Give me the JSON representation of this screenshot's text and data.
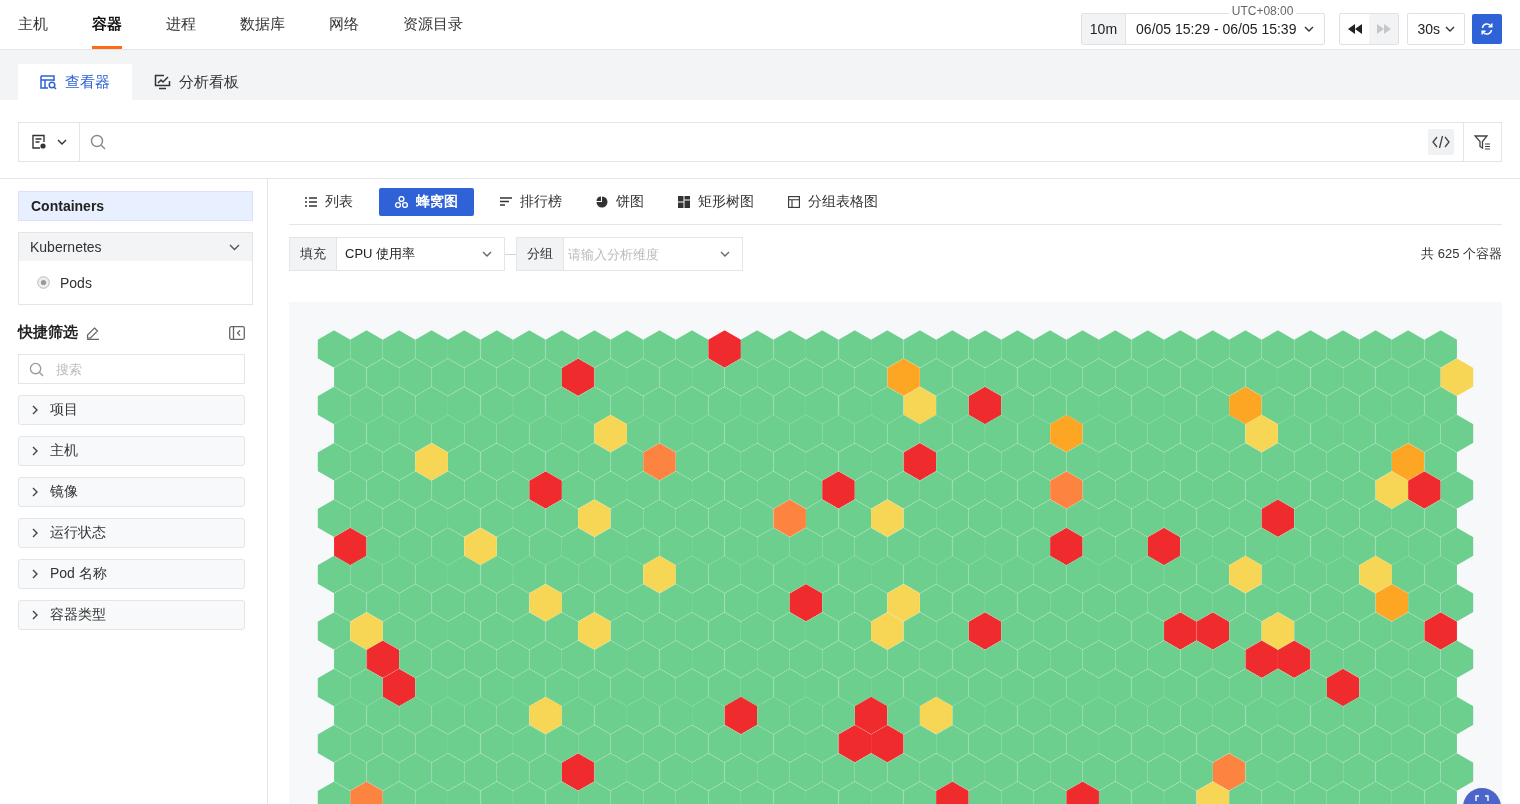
{
  "nav_tabs": [
    {
      "label": "主机",
      "selected": false
    },
    {
      "label": "容器",
      "selected": true
    },
    {
      "label": "进程",
      "selected": false
    },
    {
      "label": "数据库",
      "selected": false
    },
    {
      "label": "网络",
      "selected": false
    },
    {
      "label": "资源目录",
      "selected": false
    }
  ],
  "time_picker": {
    "timezone": "UTC+08:00",
    "quick_range": "10m",
    "range": "06/05 15:29 - 06/05 15:39"
  },
  "playback": {
    "rewind_disabled": false,
    "forward_disabled": true
  },
  "refresh_interval": "30s",
  "sub_tabs": [
    {
      "label": "查看器",
      "kind": "viewer",
      "selected": true
    },
    {
      "label": "分析看板",
      "kind": "dashboard",
      "selected": false
    }
  ],
  "sidebar": {
    "sources": [
      {
        "label": "Containers",
        "selected": true
      }
    ],
    "group": {
      "label": "Kubernetes",
      "expanded": true,
      "children": [
        {
          "label": "Pods"
        }
      ]
    },
    "quick_filter": {
      "title": "快捷筛选",
      "search_placeholder": "搜索",
      "filters": [
        {
          "label": "项目",
          "expanded": false
        },
        {
          "label": "主机",
          "expanded": false
        },
        {
          "label": "镜像",
          "expanded": false
        },
        {
          "label": "运行状态",
          "expanded": false
        },
        {
          "label": "Pod 名称",
          "expanded": false
        },
        {
          "label": "容器类型",
          "expanded": false
        }
      ]
    }
  },
  "view_tabs": [
    {
      "label": "列表",
      "kind": "list",
      "selected": false
    },
    {
      "label": "蜂窝图",
      "kind": "honeycomb",
      "selected": true
    },
    {
      "label": "排行榜",
      "kind": "ranking",
      "selected": false
    },
    {
      "label": "饼图",
      "kind": "pie",
      "selected": false
    },
    {
      "label": "矩形树图",
      "kind": "treemap",
      "selected": false
    },
    {
      "label": "分组表格图",
      "kind": "grouped-table",
      "selected": false
    }
  ],
  "fill": {
    "label": "填充",
    "value": "CPU 使用率"
  },
  "group_by": {
    "label": "分组",
    "placeholder": "请输入分析维度"
  },
  "total": "共 625 个容器",
  "honeycomb": {
    "rows": [
      [
        {
          "color": "#6dcf8e"
        },
        {
          "color": "#6dcf8e"
        },
        {
          "color": "#6dcf8e"
        },
        {
          "color": "#6dcf8e"
        },
        {
          "color": "#6dcf8e"
        },
        {
          "color": "#6dcf8e"
        },
        {
          "color": "#6dcf8e"
        },
        {
          "color": "#6dcf8e"
        },
        {
          "color": "#6dcf8e"
        },
        {
          "color": "#6dcf8e"
        },
        {
          "color": "#6dcf8e"
        },
        {
          "color": "#6dcf8e"
        },
        {
          "color": "#ef2b2d"
        },
        {
          "color": "#6dcf8e"
        },
        {
          "color": "#6dcf8e"
        },
        {
          "color": "#6dcf8e"
        },
        {
          "color": "#6dcf8e"
        },
        {
          "color": "#6dcf8e"
        },
        {
          "color": "#6dcf8e"
        },
        {
          "color": "#6dcf8e"
        },
        {
          "color": "#6dcf8e"
        },
        {
          "color": "#6dcf8e"
        },
        {
          "color": "#6dcf8e"
        },
        {
          "color": "#6dcf8e"
        },
        {
          "color": "#6dcf8e"
        },
        {
          "color": "#6dcf8e"
        },
        {
          "color": "#6dcf8e"
        },
        {
          "color": "#6dcf8e"
        },
        {
          "color": "#6dcf8e"
        },
        {
          "color": "#6dcf8e"
        },
        {
          "color": "#6dcf8e"
        },
        {
          "color": "#6dcf8e"
        },
        {
          "color": "#6dcf8e"
        },
        {
          "color": "#6dcf8e"
        },
        {
          "color": "#6dcf8e"
        }
      ],
      [
        {
          "color": "#6dcf8e"
        },
        {
          "color": "#6dcf8e"
        },
        {
          "color": "#6dcf8e"
        },
        {
          "color": "#6dcf8e"
        },
        {
          "color": "#6dcf8e"
        },
        {
          "color": "#6dcf8e"
        },
        {
          "color": "#6dcf8e"
        },
        {
          "color": "#ef2b2d"
        },
        {
          "color": "#6dcf8e"
        },
        {
          "color": "#6dcf8e"
        },
        {
          "color": "#6dcf8e"
        },
        {
          "color": "#6dcf8e"
        },
        {
          "color": "#6dcf8e"
        },
        {
          "color": "#6dcf8e"
        },
        {
          "color": "#6dcf8e"
        },
        {
          "color": "#6dcf8e"
        },
        {
          "color": "#6dcf8e"
        },
        {
          "color": "#fca623"
        },
        {
          "color": "#6dcf8e"
        },
        {
          "color": "#6dcf8e"
        },
        {
          "color": "#6dcf8e"
        },
        {
          "color": "#6dcf8e"
        },
        {
          "color": "#6dcf8e"
        },
        {
          "color": "#6dcf8e"
        },
        {
          "color": "#6dcf8e"
        },
        {
          "color": "#6dcf8e"
        },
        {
          "color": "#6dcf8e"
        },
        {
          "color": "#6dcf8e"
        },
        {
          "color": "#6dcf8e"
        },
        {
          "color": "#6dcf8e"
        },
        {
          "color": "#6dcf8e"
        },
        {
          "color": "#6dcf8e"
        },
        {
          "color": "#6dcf8e"
        },
        {
          "color": "#6dcf8e"
        },
        {
          "color": "#f6d654"
        }
      ],
      [
        {
          "color": "#6dcf8e"
        },
        {
          "color": "#6dcf8e"
        },
        {
          "color": "#6dcf8e"
        },
        {
          "color": "#6dcf8e"
        },
        {
          "color": "#6dcf8e"
        },
        {
          "color": "#6dcf8e"
        },
        {
          "color": "#6dcf8e"
        },
        {
          "color": "#6dcf8e"
        },
        {
          "color": "#6dcf8e"
        },
        {
          "color": "#6dcf8e"
        },
        {
          "color": "#6dcf8e"
        },
        {
          "color": "#6dcf8e"
        },
        {
          "color": "#6dcf8e"
        },
        {
          "color": "#6dcf8e"
        },
        {
          "color": "#6dcf8e"
        },
        {
          "color": "#6dcf8e"
        },
        {
          "color": "#6dcf8e"
        },
        {
          "color": "#6dcf8e"
        },
        {
          "color": "#f6d654"
        },
        {
          "color": "#6dcf8e"
        },
        {
          "color": "#ef2b2d"
        },
        {
          "color": "#6dcf8e"
        },
        {
          "color": "#6dcf8e"
        },
        {
          "color": "#6dcf8e"
        },
        {
          "color": "#6dcf8e"
        },
        {
          "color": "#6dcf8e"
        },
        {
          "color": "#6dcf8e"
        },
        {
          "color": "#6dcf8e"
        },
        {
          "color": "#fca623"
        },
        {
          "color": "#6dcf8e"
        },
        {
          "color": "#6dcf8e"
        },
        {
          "color": "#6dcf8e"
        },
        {
          "color": "#6dcf8e"
        },
        {
          "color": "#6dcf8e"
        },
        {
          "color": "#6dcf8e"
        }
      ],
      [
        {
          "color": "#6dcf8e"
        },
        {
          "color": "#6dcf8e"
        },
        {
          "color": "#6dcf8e"
        },
        {
          "color": "#6dcf8e"
        },
        {
          "color": "#6dcf8e"
        },
        {
          "color": "#6dcf8e"
        },
        {
          "color": "#6dcf8e"
        },
        {
          "color": "#6dcf8e"
        },
        {
          "color": "#f6d654"
        },
        {
          "color": "#6dcf8e"
        },
        {
          "color": "#6dcf8e"
        },
        {
          "color": "#6dcf8e"
        },
        {
          "color": "#6dcf8e"
        },
        {
          "color": "#6dcf8e"
        },
        {
          "color": "#6dcf8e"
        },
        {
          "color": "#6dcf8e"
        },
        {
          "color": "#6dcf8e"
        },
        {
          "color": "#6dcf8e"
        },
        {
          "color": "#6dcf8e"
        },
        {
          "color": "#6dcf8e"
        },
        {
          "color": "#6dcf8e"
        },
        {
          "color": "#6dcf8e"
        },
        {
          "color": "#fca623"
        },
        {
          "color": "#6dcf8e"
        },
        {
          "color": "#6dcf8e"
        },
        {
          "color": "#6dcf8e"
        },
        {
          "color": "#6dcf8e"
        },
        {
          "color": "#6dcf8e"
        },
        {
          "color": "#f6d654"
        },
        {
          "color": "#6dcf8e"
        },
        {
          "color": "#6dcf8e"
        },
        {
          "color": "#6dcf8e"
        },
        {
          "color": "#6dcf8e"
        },
        {
          "color": "#6dcf8e"
        },
        {
          "color": "#6dcf8e"
        }
      ],
      [
        {
          "color": "#6dcf8e"
        },
        {
          "color": "#6dcf8e"
        },
        {
          "color": "#6dcf8e"
        },
        {
          "color": "#f6d654"
        },
        {
          "color": "#6dcf8e"
        },
        {
          "color": "#6dcf8e"
        },
        {
          "color": "#6dcf8e"
        },
        {
          "color": "#6dcf8e"
        },
        {
          "color": "#6dcf8e"
        },
        {
          "color": "#6dcf8e"
        },
        {
          "color": "#fd8340"
        },
        {
          "color": "#6dcf8e"
        },
        {
          "color": "#6dcf8e"
        },
        {
          "color": "#6dcf8e"
        },
        {
          "color": "#6dcf8e"
        },
        {
          "color": "#6dcf8e"
        },
        {
          "color": "#6dcf8e"
        },
        {
          "color": "#6dcf8e"
        },
        {
          "color": "#ef2b2d"
        },
        {
          "color": "#6dcf8e"
        },
        {
          "color": "#6dcf8e"
        },
        {
          "color": "#6dcf8e"
        },
        {
          "color": "#6dcf8e"
        },
        {
          "color": "#6dcf8e"
        },
        {
          "color": "#6dcf8e"
        },
        {
          "color": "#6dcf8e"
        },
        {
          "color": "#6dcf8e"
        },
        {
          "color": "#6dcf8e"
        },
        {
          "color": "#6dcf8e"
        },
        {
          "color": "#6dcf8e"
        },
        {
          "color": "#6dcf8e"
        },
        {
          "color": "#6dcf8e"
        },
        {
          "color": "#6dcf8e"
        },
        {
          "color": "#fca623"
        },
        {
          "color": "#6dcf8e"
        }
      ],
      [
        {
          "color": "#6dcf8e"
        },
        {
          "color": "#6dcf8e"
        },
        {
          "color": "#6dcf8e"
        },
        {
          "color": "#6dcf8e"
        },
        {
          "color": "#6dcf8e"
        },
        {
          "color": "#6dcf8e"
        },
        {
          "color": "#ef2b2d"
        },
        {
          "color": "#6dcf8e"
        },
        {
          "color": "#6dcf8e"
        },
        {
          "color": "#6dcf8e"
        },
        {
          "color": "#6dcf8e"
        },
        {
          "color": "#6dcf8e"
        },
        {
          "color": "#6dcf8e"
        },
        {
          "color": "#6dcf8e"
        },
        {
          "color": "#6dcf8e"
        },
        {
          "color": "#ef2b2d"
        },
        {
          "color": "#6dcf8e"
        },
        {
          "color": "#6dcf8e"
        },
        {
          "color": "#6dcf8e"
        },
        {
          "color": "#6dcf8e"
        },
        {
          "color": "#6dcf8e"
        },
        {
          "color": "#6dcf8e"
        },
        {
          "color": "#fd8340"
        },
        {
          "color": "#6dcf8e"
        },
        {
          "color": "#6dcf8e"
        },
        {
          "color": "#6dcf8e"
        },
        {
          "color": "#6dcf8e"
        },
        {
          "color": "#6dcf8e"
        },
        {
          "color": "#6dcf8e"
        },
        {
          "color": "#6dcf8e"
        },
        {
          "color": "#6dcf8e"
        },
        {
          "color": "#6dcf8e"
        },
        {
          "color": "#f6d654"
        },
        {
          "color": "#ef2b2d"
        },
        {
          "color": "#6dcf8e"
        }
      ],
      [
        {
          "color": "#6dcf8e"
        },
        {
          "color": "#6dcf8e"
        },
        {
          "color": "#6dcf8e"
        },
        {
          "color": "#6dcf8e"
        },
        {
          "color": "#6dcf8e"
        },
        {
          "color": "#6dcf8e"
        },
        {
          "color": "#6dcf8e"
        },
        {
          "color": "#6dcf8e"
        },
        {
          "color": "#f6d654"
        },
        {
          "color": "#6dcf8e"
        },
        {
          "color": "#6dcf8e"
        },
        {
          "color": "#6dcf8e"
        },
        {
          "color": "#6dcf8e"
        },
        {
          "color": "#6dcf8e"
        },
        {
          "color": "#fd8340"
        },
        {
          "color": "#6dcf8e"
        },
        {
          "color": "#6dcf8e"
        },
        {
          "color": "#f6d654"
        },
        {
          "color": "#6dcf8e"
        },
        {
          "color": "#6dcf8e"
        },
        {
          "color": "#6dcf8e"
        },
        {
          "color": "#6dcf8e"
        },
        {
          "color": "#6dcf8e"
        },
        {
          "color": "#6dcf8e"
        },
        {
          "color": "#6dcf8e"
        },
        {
          "color": "#6dcf8e"
        },
        {
          "color": "#6dcf8e"
        },
        {
          "color": "#6dcf8e"
        },
        {
          "color": "#6dcf8e"
        },
        {
          "color": "#ef2b2d"
        },
        {
          "color": "#6dcf8e"
        },
        {
          "color": "#6dcf8e"
        },
        {
          "color": "#6dcf8e"
        },
        {
          "color": "#6dcf8e"
        },
        {
          "color": "#6dcf8e"
        }
      ],
      [
        {
          "color": "#ef2b2d"
        },
        {
          "color": "#6dcf8e"
        },
        {
          "color": "#6dcf8e"
        },
        {
          "color": "#6dcf8e"
        },
        {
          "color": "#f6d654"
        },
        {
          "color": "#6dcf8e"
        },
        {
          "color": "#6dcf8e"
        },
        {
          "color": "#6dcf8e"
        },
        {
          "color": "#6dcf8e"
        },
        {
          "color": "#6dcf8e"
        },
        {
          "color": "#6dcf8e"
        },
        {
          "color": "#6dcf8e"
        },
        {
          "color": "#6dcf8e"
        },
        {
          "color": "#6dcf8e"
        },
        {
          "color": "#6dcf8e"
        },
        {
          "color": "#6dcf8e"
        },
        {
          "color": "#6dcf8e"
        },
        {
          "color": "#6dcf8e"
        },
        {
          "color": "#6dcf8e"
        },
        {
          "color": "#6dcf8e"
        },
        {
          "color": "#6dcf8e"
        },
        {
          "color": "#6dcf8e"
        },
        {
          "color": "#ef2b2d"
        },
        {
          "color": "#6dcf8e"
        },
        {
          "color": "#6dcf8e"
        },
        {
          "color": "#ef2b2d"
        },
        {
          "color": "#6dcf8e"
        },
        {
          "color": "#6dcf8e"
        },
        {
          "color": "#6dcf8e"
        },
        {
          "color": "#6dcf8e"
        },
        {
          "color": "#6dcf8e"
        },
        {
          "color": "#6dcf8e"
        },
        {
          "color": "#6dcf8e"
        },
        {
          "color": "#6dcf8e"
        },
        {
          "color": "#6dcf8e"
        }
      ],
      [
        {
          "color": "#6dcf8e"
        },
        {
          "color": "#6dcf8e"
        },
        {
          "color": "#6dcf8e"
        },
        {
          "color": "#6dcf8e"
        },
        {
          "color": "#6dcf8e"
        },
        {
          "color": "#6dcf8e"
        },
        {
          "color": "#6dcf8e"
        },
        {
          "color": "#6dcf8e"
        },
        {
          "color": "#6dcf8e"
        },
        {
          "color": "#6dcf8e"
        },
        {
          "color": "#f6d654"
        },
        {
          "color": "#6dcf8e"
        },
        {
          "color": "#6dcf8e"
        },
        {
          "color": "#6dcf8e"
        },
        {
          "color": "#6dcf8e"
        },
        {
          "color": "#6dcf8e"
        },
        {
          "color": "#6dcf8e"
        },
        {
          "color": "#6dcf8e"
        },
        {
          "color": "#6dcf8e"
        },
        {
          "color": "#6dcf8e"
        },
        {
          "color": "#6dcf8e"
        },
        {
          "color": "#6dcf8e"
        },
        {
          "color": "#6dcf8e"
        },
        {
          "color": "#6dcf8e"
        },
        {
          "color": "#6dcf8e"
        },
        {
          "color": "#6dcf8e"
        },
        {
          "color": "#6dcf8e"
        },
        {
          "color": "#6dcf8e"
        },
        {
          "color": "#f6d654"
        },
        {
          "color": "#6dcf8e"
        },
        {
          "color": "#6dcf8e"
        },
        {
          "color": "#6dcf8e"
        },
        {
          "color": "#f6d654"
        },
        {
          "color": "#6dcf8e"
        },
        {
          "color": "#6dcf8e"
        }
      ],
      [
        {
          "color": "#6dcf8e"
        },
        {
          "color": "#6dcf8e"
        },
        {
          "color": "#6dcf8e"
        },
        {
          "color": "#6dcf8e"
        },
        {
          "color": "#6dcf8e"
        },
        {
          "color": "#6dcf8e"
        },
        {
          "color": "#f6d654"
        },
        {
          "color": "#6dcf8e"
        },
        {
          "color": "#6dcf8e"
        },
        {
          "color": "#6dcf8e"
        },
        {
          "color": "#6dcf8e"
        },
        {
          "color": "#6dcf8e"
        },
        {
          "color": "#6dcf8e"
        },
        {
          "color": "#6dcf8e"
        },
        {
          "color": "#ef2b2d"
        },
        {
          "color": "#6dcf8e"
        },
        {
          "color": "#6dcf8e"
        },
        {
          "color": "#f6d654"
        },
        {
          "color": "#6dcf8e"
        },
        {
          "color": "#6dcf8e"
        },
        {
          "color": "#6dcf8e"
        },
        {
          "color": "#6dcf8e"
        },
        {
          "color": "#6dcf8e"
        },
        {
          "color": "#6dcf8e"
        },
        {
          "color": "#6dcf8e"
        },
        {
          "color": "#6dcf8e"
        },
        {
          "color": "#6dcf8e"
        },
        {
          "color": "#6dcf8e"
        },
        {
          "color": "#6dcf8e"
        },
        {
          "color": "#6dcf8e"
        },
        {
          "color": "#6dcf8e"
        },
        {
          "color": "#6dcf8e"
        },
        {
          "color": "#fca623"
        },
        {
          "color": "#6dcf8e"
        },
        {
          "color": "#6dcf8e"
        }
      ],
      [
        {
          "color": "#6dcf8e"
        },
        {
          "color": "#f6d654"
        },
        {
          "color": "#6dcf8e"
        },
        {
          "color": "#6dcf8e"
        },
        {
          "color": "#6dcf8e"
        },
        {
          "color": "#6dcf8e"
        },
        {
          "color": "#6dcf8e"
        },
        {
          "color": "#6dcf8e"
        },
        {
          "color": "#f6d654"
        },
        {
          "color": "#6dcf8e"
        },
        {
          "color": "#6dcf8e"
        },
        {
          "color": "#6dcf8e"
        },
        {
          "color": "#6dcf8e"
        },
        {
          "color": "#6dcf8e"
        },
        {
          "color": "#6dcf8e"
        },
        {
          "color": "#6dcf8e"
        },
        {
          "color": "#6dcf8e"
        },
        {
          "color": "#f6d654"
        },
        {
          "color": "#6dcf8e"
        },
        {
          "color": "#6dcf8e"
        },
        {
          "color": "#ef2b2d"
        },
        {
          "color": "#6dcf8e"
        },
        {
          "color": "#6dcf8e"
        },
        {
          "color": "#6dcf8e"
        },
        {
          "color": "#6dcf8e"
        },
        {
          "color": "#6dcf8e"
        },
        {
          "color": "#ef2b2d"
        },
        {
          "color": "#ef2b2d"
        },
        {
          "color": "#6dcf8e"
        },
        {
          "color": "#f6d654"
        },
        {
          "color": "#6dcf8e"
        },
        {
          "color": "#6dcf8e"
        },
        {
          "color": "#6dcf8e"
        },
        {
          "color": "#6dcf8e"
        },
        {
          "color": "#ef2b2d"
        }
      ],
      [
        {
          "color": "#6dcf8e"
        },
        {
          "color": "#ef2b2d"
        },
        {
          "color": "#6dcf8e"
        },
        {
          "color": "#6dcf8e"
        },
        {
          "color": "#6dcf8e"
        },
        {
          "color": "#6dcf8e"
        },
        {
          "color": "#6dcf8e"
        },
        {
          "color": "#6dcf8e"
        },
        {
          "color": "#6dcf8e"
        },
        {
          "color": "#6dcf8e"
        },
        {
          "color": "#6dcf8e"
        },
        {
          "color": "#6dcf8e"
        },
        {
          "color": "#6dcf8e"
        },
        {
          "color": "#6dcf8e"
        },
        {
          "color": "#6dcf8e"
        },
        {
          "color": "#6dcf8e"
        },
        {
          "color": "#6dcf8e"
        },
        {
          "color": "#6dcf8e"
        },
        {
          "color": "#6dcf8e"
        },
        {
          "color": "#6dcf8e"
        },
        {
          "color": "#6dcf8e"
        },
        {
          "color": "#6dcf8e"
        },
        {
          "color": "#6dcf8e"
        },
        {
          "color": "#6dcf8e"
        },
        {
          "color": "#6dcf8e"
        },
        {
          "color": "#6dcf8e"
        },
        {
          "color": "#6dcf8e"
        },
        {
          "color": "#6dcf8e"
        },
        {
          "color": "#ef2b2d"
        },
        {
          "color": "#ef2b2d"
        },
        {
          "color": "#6dcf8e"
        },
        {
          "color": "#6dcf8e"
        },
        {
          "color": "#6dcf8e"
        },
        {
          "color": "#6dcf8e"
        },
        {
          "color": "#6dcf8e"
        }
      ],
      [
        {
          "color": "#6dcf8e"
        },
        {
          "color": "#6dcf8e"
        },
        {
          "color": "#ef2b2d"
        },
        {
          "color": "#6dcf8e"
        },
        {
          "color": "#6dcf8e"
        },
        {
          "color": "#6dcf8e"
        },
        {
          "color": "#6dcf8e"
        },
        {
          "color": "#6dcf8e"
        },
        {
          "color": "#6dcf8e"
        },
        {
          "color": "#6dcf8e"
        },
        {
          "color": "#6dcf8e"
        },
        {
          "color": "#6dcf8e"
        },
        {
          "color": "#6dcf8e"
        },
        {
          "color": "#6dcf8e"
        },
        {
          "color": "#6dcf8e"
        },
        {
          "color": "#6dcf8e"
        },
        {
          "color": "#6dcf8e"
        },
        {
          "color": "#6dcf8e"
        },
        {
          "color": "#6dcf8e"
        },
        {
          "color": "#6dcf8e"
        },
        {
          "color": "#6dcf8e"
        },
        {
          "color": "#6dcf8e"
        },
        {
          "color": "#6dcf8e"
        },
        {
          "color": "#6dcf8e"
        },
        {
          "color": "#6dcf8e"
        },
        {
          "color": "#6dcf8e"
        },
        {
          "color": "#6dcf8e"
        },
        {
          "color": "#6dcf8e"
        },
        {
          "color": "#6dcf8e"
        },
        {
          "color": "#6dcf8e"
        },
        {
          "color": "#6dcf8e"
        },
        {
          "color": "#ef2b2d"
        },
        {
          "color": "#6dcf8e"
        },
        {
          "color": "#6dcf8e"
        },
        {
          "color": "#6dcf8e"
        }
      ],
      [
        {
          "color": "#6dcf8e"
        },
        {
          "color": "#6dcf8e"
        },
        {
          "color": "#6dcf8e"
        },
        {
          "color": "#6dcf8e"
        },
        {
          "color": "#6dcf8e"
        },
        {
          "color": "#6dcf8e"
        },
        {
          "color": "#f6d654"
        },
        {
          "color": "#6dcf8e"
        },
        {
          "color": "#6dcf8e"
        },
        {
          "color": "#6dcf8e"
        },
        {
          "color": "#6dcf8e"
        },
        {
          "color": "#6dcf8e"
        },
        {
          "color": "#ef2b2d"
        },
        {
          "color": "#6dcf8e"
        },
        {
          "color": "#6dcf8e"
        },
        {
          "color": "#6dcf8e"
        },
        {
          "color": "#ef2b2d"
        },
        {
          "color": "#6dcf8e"
        },
        {
          "color": "#f6d654"
        },
        {
          "color": "#6dcf8e"
        },
        {
          "color": "#6dcf8e"
        },
        {
          "color": "#6dcf8e"
        },
        {
          "color": "#6dcf8e"
        },
        {
          "color": "#6dcf8e"
        },
        {
          "color": "#6dcf8e"
        },
        {
          "color": "#6dcf8e"
        },
        {
          "color": "#6dcf8e"
        },
        {
          "color": "#6dcf8e"
        },
        {
          "color": "#6dcf8e"
        },
        {
          "color": "#6dcf8e"
        },
        {
          "color": "#6dcf8e"
        },
        {
          "color": "#6dcf8e"
        },
        {
          "color": "#6dcf8e"
        },
        {
          "color": "#6dcf8e"
        },
        {
          "color": "#6dcf8e"
        }
      ],
      [
        {
          "color": "#6dcf8e"
        },
        {
          "color": "#6dcf8e"
        },
        {
          "color": "#6dcf8e"
        },
        {
          "color": "#6dcf8e"
        },
        {
          "color": "#6dcf8e"
        },
        {
          "color": "#6dcf8e"
        },
        {
          "color": "#6dcf8e"
        },
        {
          "color": "#6dcf8e"
        },
        {
          "color": "#6dcf8e"
        },
        {
          "color": "#6dcf8e"
        },
        {
          "color": "#6dcf8e"
        },
        {
          "color": "#6dcf8e"
        },
        {
          "color": "#6dcf8e"
        },
        {
          "color": "#6dcf8e"
        },
        {
          "color": "#6dcf8e"
        },
        {
          "color": "#6dcf8e"
        },
        {
          "color": "#ef2b2d"
        },
        {
          "color": "#ef2b2d"
        },
        {
          "color": "#6dcf8e"
        },
        {
          "color": "#6dcf8e"
        },
        {
          "color": "#6dcf8e"
        },
        {
          "color": "#6dcf8e"
        },
        {
          "color": "#6dcf8e"
        },
        {
          "color": "#6dcf8e"
        },
        {
          "color": "#6dcf8e"
        },
        {
          "color": "#6dcf8e"
        },
        {
          "color": "#6dcf8e"
        },
        {
          "color": "#6dcf8e"
        },
        {
          "color": "#6dcf8e"
        },
        {
          "color": "#6dcf8e"
        },
        {
          "color": "#6dcf8e"
        },
        {
          "color": "#6dcf8e"
        },
        {
          "color": "#6dcf8e"
        },
        {
          "color": "#6dcf8e"
        },
        {
          "color": "#6dcf8e"
        }
      ],
      [
        {
          "color": "#6dcf8e"
        },
        {
          "color": "#6dcf8e"
        },
        {
          "color": "#6dcf8e"
        },
        {
          "color": "#6dcf8e"
        },
        {
          "color": "#6dcf8e"
        },
        {
          "color": "#6dcf8e"
        },
        {
          "color": "#6dcf8e"
        },
        {
          "color": "#ef2b2d"
        },
        {
          "color": "#6dcf8e"
        },
        {
          "color": "#6dcf8e"
        },
        {
          "color": "#6dcf8e"
        },
        {
          "color": "#6dcf8e"
        },
        {
          "color": "#6dcf8e"
        },
        {
          "color": "#6dcf8e"
        },
        {
          "color": "#6dcf8e"
        },
        {
          "color": "#6dcf8e"
        },
        {
          "color": "#6dcf8e"
        },
        {
          "color": "#6dcf8e"
        },
        {
          "color": "#6dcf8e"
        },
        {
          "color": "#6dcf8e"
        },
        {
          "color": "#6dcf8e"
        },
        {
          "color": "#6dcf8e"
        },
        {
          "color": "#6dcf8e"
        },
        {
          "color": "#6dcf8e"
        },
        {
          "color": "#6dcf8e"
        },
        {
          "color": "#6dcf8e"
        },
        {
          "color": "#6dcf8e"
        },
        {
          "color": "#fd8340"
        },
        {
          "color": "#6dcf8e"
        },
        {
          "color": "#6dcf8e"
        },
        {
          "color": "#6dcf8e"
        },
        {
          "color": "#6dcf8e"
        },
        {
          "color": "#6dcf8e"
        },
        {
          "color": "#6dcf8e"
        },
        {
          "color": "#6dcf8e"
        }
      ],
      [
        {
          "color": "#6dcf8e"
        },
        {
          "color": "#fd8340"
        },
        {
          "color": "#6dcf8e"
        },
        {
          "color": "#6dcf8e"
        },
        {
          "color": "#6dcf8e"
        },
        {
          "color": "#6dcf8e"
        },
        {
          "color": "#6dcf8e"
        },
        {
          "color": "#6dcf8e"
        },
        {
          "color": "#6dcf8e"
        },
        {
          "color": "#6dcf8e"
        },
        {
          "color": "#6dcf8e"
        },
        {
          "color": "#6dcf8e"
        },
        {
          "color": "#6dcf8e"
        },
        {
          "color": "#6dcf8e"
        },
        {
          "color": "#6dcf8e"
        },
        {
          "color": "#6dcf8e"
        },
        {
          "color": "#6dcf8e"
        },
        {
          "color": "#6dcf8e"
        },
        {
          "color": "#6dcf8e"
        },
        {
          "color": "#ef2b2d"
        },
        {
          "color": "#6dcf8e"
        },
        {
          "color": "#6dcf8e"
        },
        {
          "color": "#6dcf8e"
        },
        {
          "color": "#ef2b2d"
        },
        {
          "color": "#6dcf8e"
        },
        {
          "color": "#6dcf8e"
        },
        {
          "color": "#6dcf8e"
        },
        {
          "color": "#f6d654"
        },
        {
          "color": "#6dcf8e"
        },
        {
          "color": "#6dcf8e"
        },
        {
          "color": "#6dcf8e"
        },
        {
          "color": "#6dcf8e"
        },
        {
          "color": "#6dcf8e"
        },
        {
          "color": "#6dcf8e"
        },
        {
          "color": "#6dcf8e"
        }
      ]
    ]
  }
}
